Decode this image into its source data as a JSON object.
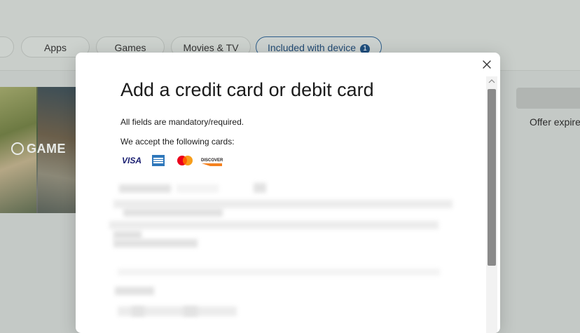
{
  "store": {
    "tabs": [
      {
        "label": ""
      },
      {
        "label": "Apps"
      },
      {
        "label": "Games"
      },
      {
        "label": "Movies & TV"
      },
      {
        "label": "Included with device",
        "badge": "1"
      }
    ],
    "hero_text": "GAME",
    "offer_text": "Offer expire"
  },
  "dialog": {
    "title": "Add a credit card or debit card",
    "mandatory_note": "All fields are mandatory/required.",
    "accept_note": "We accept the following cards:",
    "cards": [
      {
        "name": "VISA",
        "color": "#1a1f71"
      },
      {
        "name": "American Express",
        "color": "#2e77bb"
      },
      {
        "name": "Mastercard",
        "color": "#eb001b"
      },
      {
        "name": "DISCOVER",
        "color": "#f58220"
      }
    ],
    "close_icon": "close-icon"
  },
  "colors": {
    "backdrop": "#c4c9c6",
    "accent": "#1f4f7e",
    "scroll_thumb": "#8a8a8a"
  }
}
